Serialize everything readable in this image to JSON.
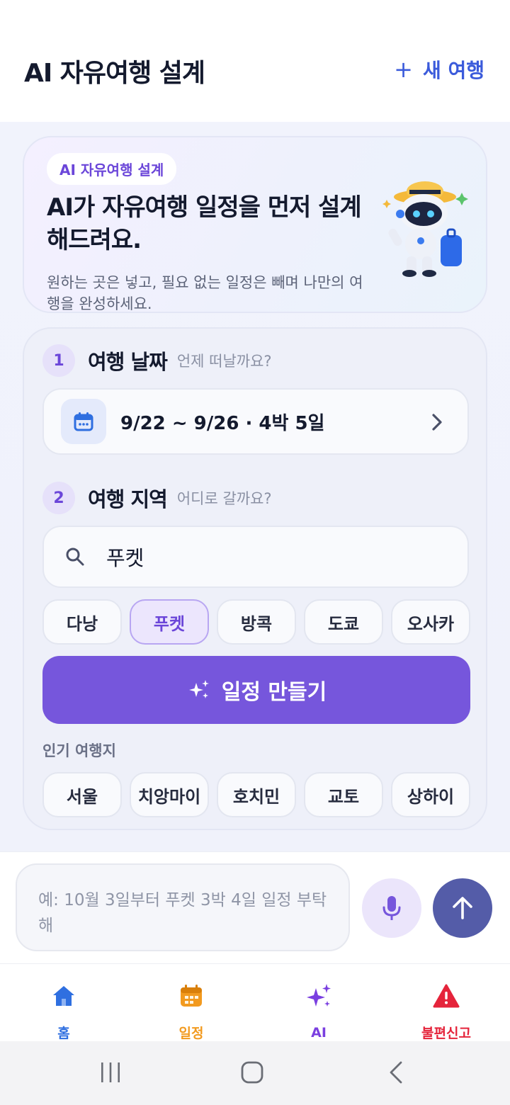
{
  "header": {
    "title": "AI 자유여행 설계",
    "new_trip_label": "새 여행",
    "new_trip_icon": "plus-icon"
  },
  "hero": {
    "badge": "AI 자유여행 설계",
    "title": "AI가 자유여행 일정을 먼저 설계해드려요.",
    "description": "원하는 곳은 넣고, 필요 없는 일정은 빼며 나만의 여행을 완성하세요."
  },
  "step1": {
    "number": "1",
    "title": "여행 날짜",
    "subtitle": "언제 떠날까요?",
    "date_value": "9/22 ~ 9/26 · 4박 5일"
  },
  "step2": {
    "number": "2",
    "title": "여행 지역",
    "subtitle": "어디로 갈까요?",
    "search_value": "푸켓"
  },
  "region_chips": [
    {
      "label": "다낭",
      "selected": false
    },
    {
      "label": "푸켓",
      "selected": true
    },
    {
      "label": "방콕",
      "selected": false
    },
    {
      "label": "도쿄",
      "selected": false
    },
    {
      "label": "오사카",
      "selected": false
    }
  ],
  "create_button": {
    "label": "일정 만들기",
    "icon": "sparkle-icon"
  },
  "popular": {
    "label": "인기 여행지",
    "items": [
      "서울",
      "치앙마이",
      "호치민",
      "교토",
      "상하이"
    ]
  },
  "composer": {
    "placeholder": "예: 10월 3일부터 푸켓 3박 4일 일정 부탁해"
  },
  "tabs": [
    {
      "label": "홈",
      "icon": "home-icon",
      "color": "#2f6fe0"
    },
    {
      "label": "일정",
      "icon": "calendar-icon",
      "color": "#f29a1f"
    },
    {
      "label": "AI",
      "icon": "sparkle-icon",
      "color": "#7a3fe0"
    },
    {
      "label": "불편신고",
      "icon": "warning-icon",
      "color": "#e5243b"
    }
  ],
  "colors": {
    "accent": "#7656dc",
    "primary_blue": "#3b5bdb",
    "send_button": "#545ca8"
  }
}
